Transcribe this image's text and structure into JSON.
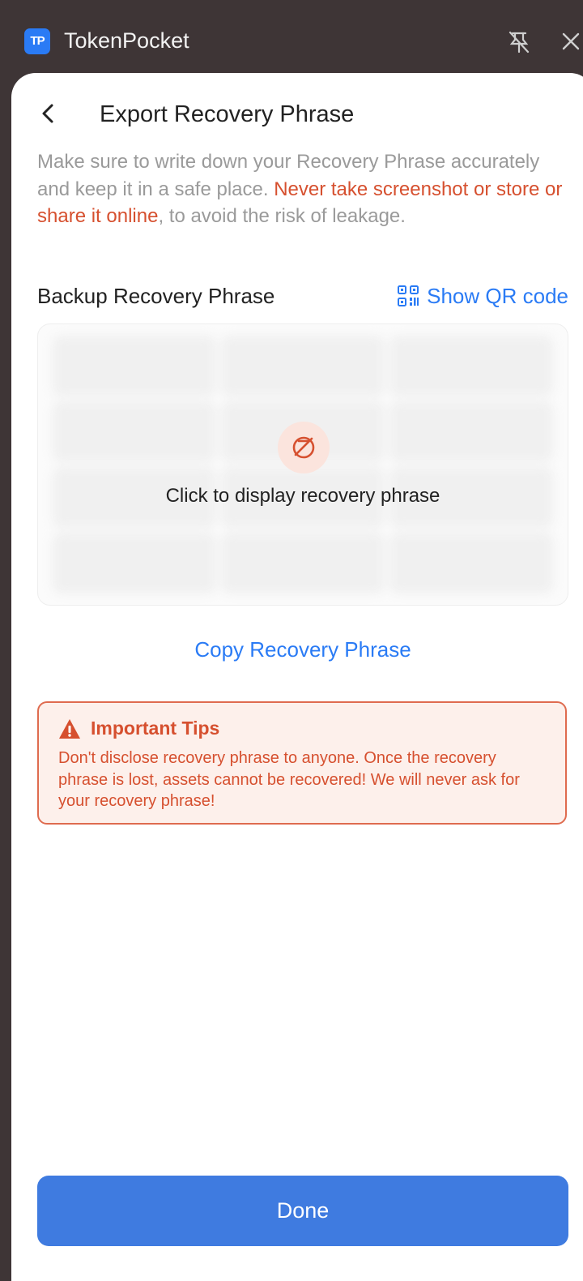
{
  "app": {
    "logo_text": "TP",
    "title": "TokenPocket",
    "icons": [
      "pin-off-icon",
      "close-icon"
    ]
  },
  "page": {
    "title": "Export Recovery Phrase",
    "back_icon": "chevron-left-icon"
  },
  "intro": {
    "text_before": "Make sure to write down your Recovery Phrase accurately and keep it in a safe place. ",
    "warning": "Never take screenshot or store or share it online",
    "text_after": ", to avoid the risk of leakage."
  },
  "backup": {
    "title": "Backup Recovery Phrase",
    "qr_label": "Show QR code",
    "qr_icon": "qr-code-icon",
    "reveal_label": "Click to display recovery phrase",
    "reveal_icon": "eye-off-icon",
    "copy_label": "Copy Recovery Phrase"
  },
  "tips": {
    "title": "Important Tips",
    "icon": "warning-icon",
    "body": "Don't disclose recovery phrase to anyone. Once the recovery phrase is lost, assets cannot be recovered! We will never ask for your recovery phrase!"
  },
  "footer": {
    "done_label": "Done"
  },
  "colors": {
    "accent": "#2a7bf5",
    "button": "#3f7be0",
    "warning": "#d6502f",
    "warning_bg": "#fdf0eb",
    "frame": "#3e3536"
  }
}
